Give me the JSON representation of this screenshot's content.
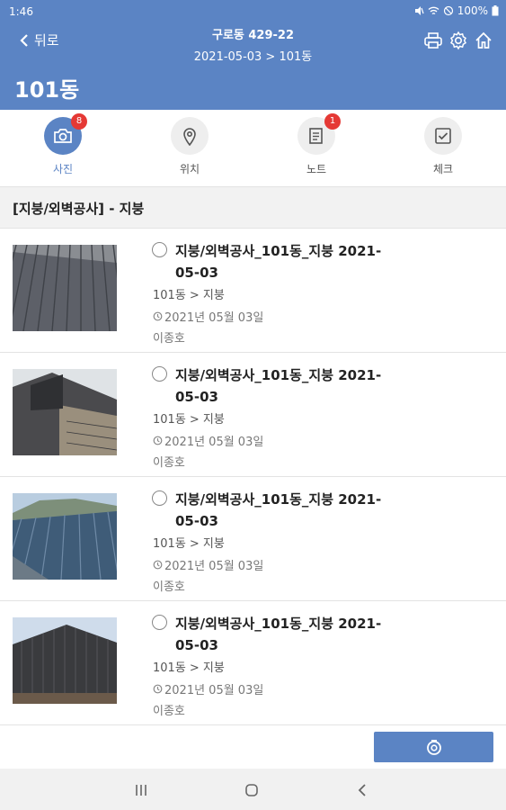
{
  "status_bar": {
    "time": "1:46",
    "battery": "100%"
  },
  "header": {
    "back_label": "뒤로",
    "title": "구로동 429-22",
    "subtitle": "2021-05-03 > 101동",
    "page_title": "101동",
    "icons": [
      "print-icon",
      "gear-icon",
      "home-icon"
    ]
  },
  "tabs": [
    {
      "label": "사진",
      "icon": "camera-icon",
      "badge": "8",
      "active": true
    },
    {
      "label": "위치",
      "icon": "location-pin-icon",
      "badge": null,
      "active": false
    },
    {
      "label": "노트",
      "icon": "note-icon",
      "badge": "1",
      "active": false
    },
    {
      "label": "체크",
      "icon": "checkbox-icon",
      "badge": null,
      "active": false
    }
  ],
  "section": {
    "title": "[지붕/외벽공사] - 지붕"
  },
  "items": [
    {
      "title": "지붕/외벽공사_101동_지붕 2021-05-03",
      "path": "101동 > 지붕",
      "date": "2021년 05월 03일",
      "author": "이종호"
    },
    {
      "title": "지붕/외벽공사_101동_지붕 2021-05-03",
      "path": "101동 > 지붕",
      "date": "2021년 05월 03일",
      "author": "이종호"
    },
    {
      "title": "지붕/외벽공사_101동_지붕 2021-05-03",
      "path": "101동 > 지붕",
      "date": "2021년 05월 03일",
      "author": "이종호"
    },
    {
      "title": "지붕/외벽공사_101동_지붕 2021-05-03",
      "path": "101동 > 지붕",
      "date": "2021년 05월 03일",
      "author": "이종호"
    }
  ],
  "footer": {
    "button_icon": "camera-icon"
  },
  "colors": {
    "primary": "#5b84c4",
    "badge": "#e53935",
    "background": "#ffffff",
    "section_bg": "#f2f2f2"
  }
}
